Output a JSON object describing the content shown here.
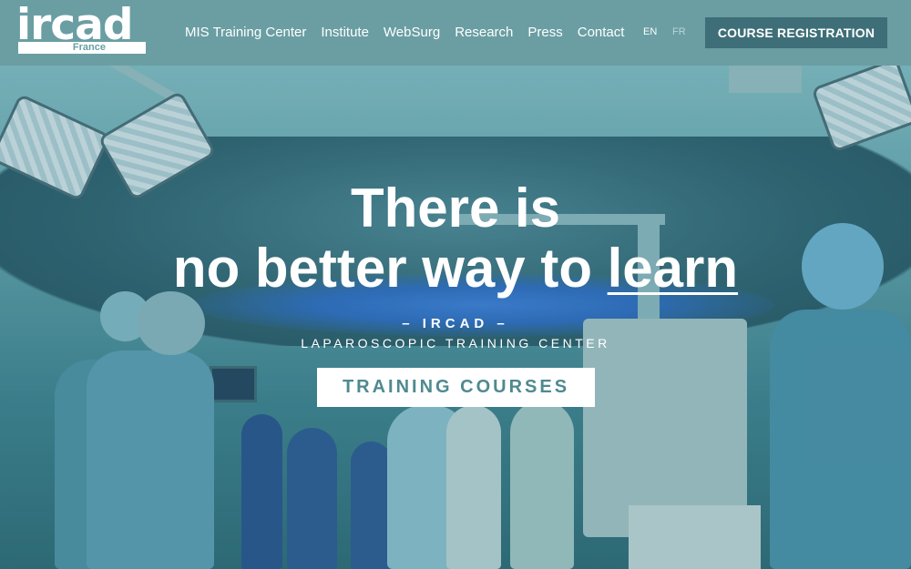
{
  "logo": {
    "word": "ircad",
    "sub": "France"
  },
  "nav": {
    "items": [
      {
        "label": "MIS Training Center"
      },
      {
        "label": "Institute"
      },
      {
        "label": "WebSurg"
      },
      {
        "label": "Research"
      },
      {
        "label": "Press"
      },
      {
        "label": "Contact"
      }
    ]
  },
  "lang": {
    "en": "EN",
    "fr": "FR",
    "active": "EN"
  },
  "cta": {
    "register_label": "COURSE REGISTRATION"
  },
  "hero": {
    "headline_line1": "There is",
    "headline_line2_prefix": "no better way to ",
    "headline_line2_emph": "learn",
    "subtitle1": "– IRCAD –",
    "subtitle2": "LAPAROSCOPIC TRAINING CENTER",
    "button_label": "TRAINING COURSES"
  },
  "colors": {
    "header_bg": "#6a9ea3",
    "register_bg": "#3e6f78",
    "button_text": "#4e8a90"
  }
}
